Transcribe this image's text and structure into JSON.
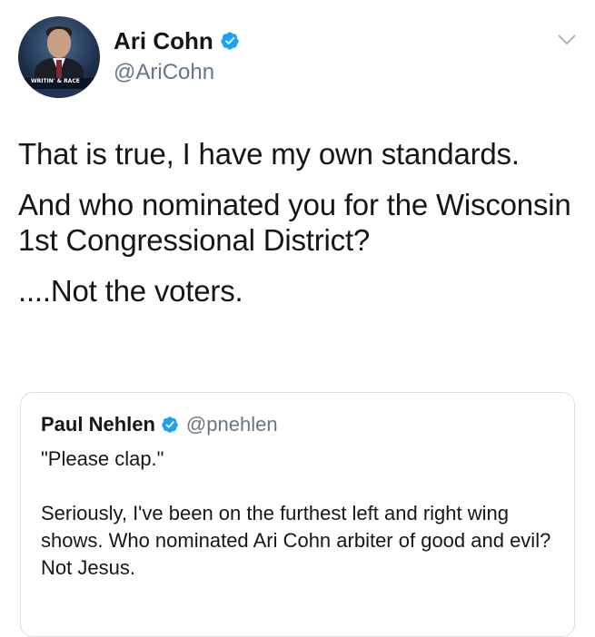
{
  "tweet": {
    "author": {
      "display_name": "Ari Cohn",
      "handle": "@AriCohn",
      "verified": true,
      "avatar_banner_text": "WRITIN' & RACE"
    },
    "menu_icon": "chevron-down-icon",
    "text_paragraphs": [
      "That is true, I have my own standards.",
      "And who nominated you for the Wisconsin 1st Congressional District?",
      "....Not the voters."
    ]
  },
  "quoted_tweet": {
    "author": {
      "display_name": "Paul Nehlen",
      "handle": "@pnehlen",
      "verified": true
    },
    "text_paragraphs": [
      "\"Please clap.\"",
      "Seriously, I've been on the furthest left and right wing shows. Who nominated Ari Cohn arbiter of good and evil? Not Jesus."
    ]
  },
  "colors": {
    "verified_badge": "#1da1f2",
    "secondary_text": "#657786",
    "primary_text": "#14171a",
    "card_border": "#d8dfe6"
  }
}
